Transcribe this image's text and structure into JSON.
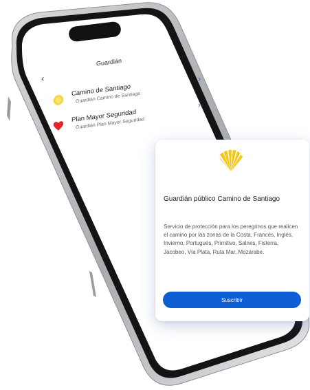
{
  "app": {
    "screen_title": "Guardián"
  },
  "services": [
    {
      "name": "Camino de Santiago",
      "subtitle": "Guardián Camino de Santiago",
      "icon": "camino-shell-icon"
    },
    {
      "name": "Plan Mayor Seguridad",
      "subtitle": "Guardián Plan Mayor Seguridad",
      "icon": "heart-icon"
    }
  ],
  "card": {
    "icon": "camino-shell-icon",
    "title": "Guardián público Camino de Santiago",
    "description": "Servicio de protección para los peregrinos que realicen el camino por las zonas de la Costa, Francés, Inglés, Invierno, Portugués, Primitivo, Salnes, Fisterra, Jacobeo, Vía Plata, Ruta Mar, Mozárabe.",
    "button_label": "Suscribir"
  },
  "colors": {
    "accent": "#0d5fd3",
    "shell_yellow": "#f5c518",
    "heart_red": "#e3262e",
    "phone_frame": "#1a1a1a"
  }
}
